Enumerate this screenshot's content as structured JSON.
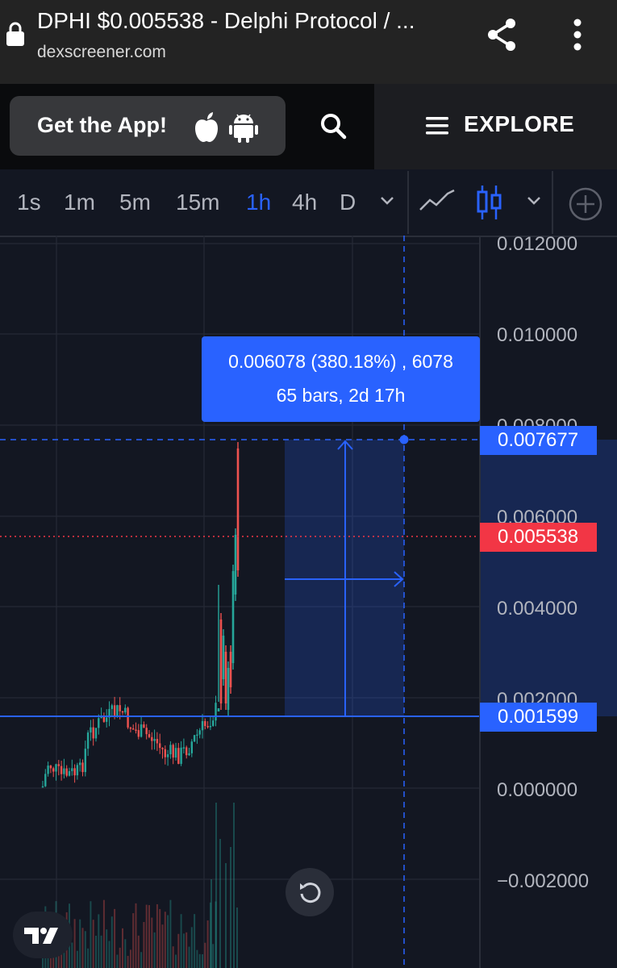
{
  "browser": {
    "title": "DPHI $0.005538 - Delphi Protocol / ...",
    "url": "dexscreener.com",
    "icons": [
      "lock-icon",
      "share-icon",
      "more-vert-icon"
    ]
  },
  "header": {
    "get_app_label": "Get the App!",
    "explore_label": "EXPLORE",
    "icons": [
      "apple-icon",
      "android-icon",
      "search-icon",
      "hamburger-icon"
    ]
  },
  "toolbar": {
    "timeframes": [
      "1s",
      "1m",
      "5m",
      "15m",
      "1h",
      "4h",
      "D"
    ],
    "active_timeframe": "1h",
    "icons": [
      "chevron-down-icon",
      "line-chart-icon",
      "candles-icon",
      "plus-circle-icon"
    ]
  },
  "chart": {
    "price_axis": [
      "0.012000",
      "0.010000",
      "0.008000",
      "0.006000",
      "0.004000",
      "0.002000",
      "0.000000",
      "−0.002000"
    ],
    "measure": {
      "line1": "0.006078 (380.18%) , 6078",
      "line2": "65 bars, 2d 17h"
    },
    "tags": {
      "top": "0.007677",
      "current": "0.005538",
      "bottom": "0.001599"
    },
    "colors": {
      "up": "#26a69a",
      "down": "#ef5350",
      "accent": "#2962ff",
      "current_price": "#f23645"
    },
    "icons": [
      "reset-icon",
      "tradingview-logo-icon"
    ]
  }
}
